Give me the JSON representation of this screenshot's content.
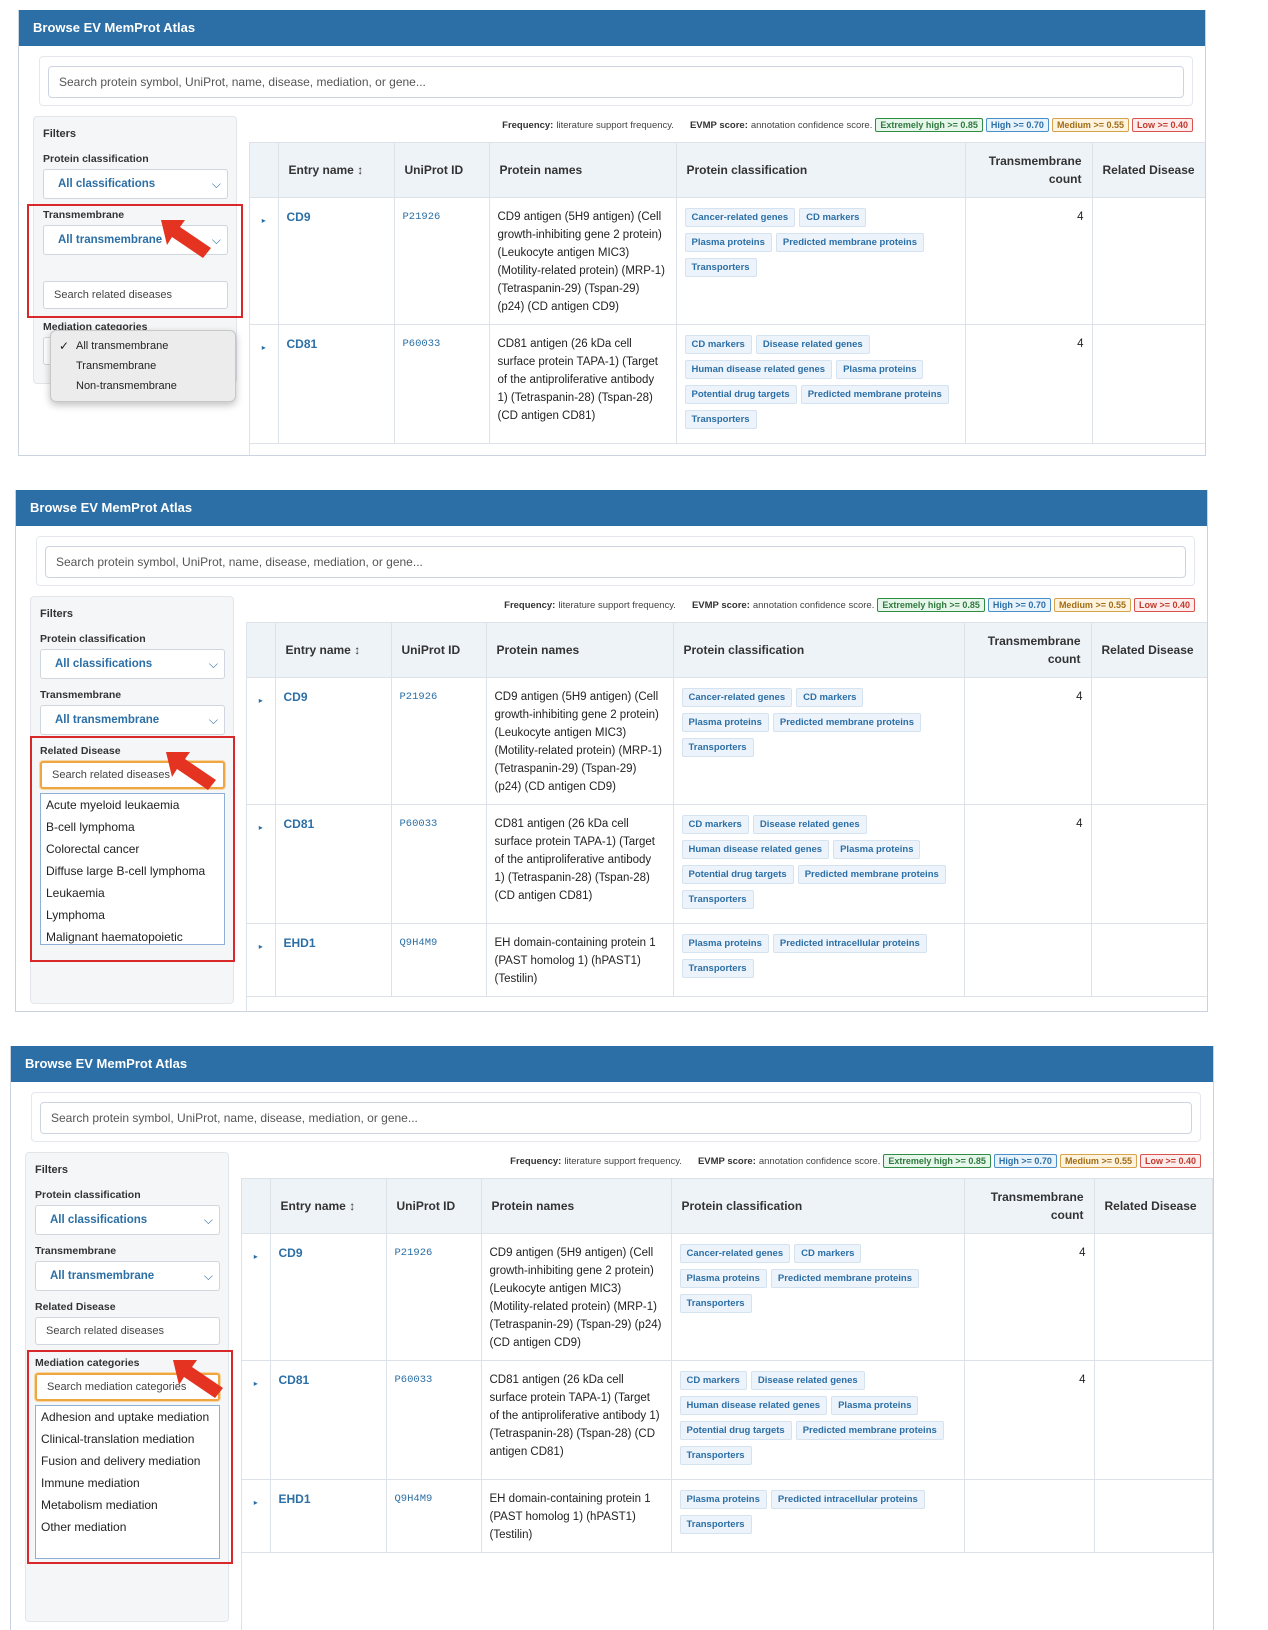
{
  "app_title": "Browse EV MemProt Atlas",
  "search_placeholder": "Search protein symbol, UniProt, name, disease, mediation, or gene...",
  "filters": {
    "title": "Filters",
    "protein_classification_label": "Protein classification",
    "protein_classification_value": "All classifications",
    "transmembrane_label": "Transmembrane",
    "transmembrane_value": "All transmembrane",
    "transmembrane_options": [
      "All transmembrane",
      "Transmembrane",
      "Non-transmembrane"
    ],
    "related_disease_label": "Related Disease",
    "related_disease_placeholder": "Search related diseases",
    "related_disease_partial": "Search related diseases",
    "mediation_label": "Mediation categories",
    "mediation_placeholder": "Search mediation categories"
  },
  "legend": {
    "frequency_label": "Frequency:",
    "frequency_text": "literature support frequency.",
    "evmp_label": "EVMP score:",
    "evmp_text": "annotation confidence score.",
    "badges": [
      "Extremely high >= 0.85",
      "High >= 0.70",
      "Medium >= 0.55",
      "Low >= 0.40"
    ]
  },
  "columns": [
    "Entry name ↕",
    "UniProt ID",
    "Protein names",
    "Protein classification",
    "Transmembrane count",
    "Related Disease"
  ],
  "rows": [
    {
      "entry": "CD9",
      "uniprot": "P21926",
      "names": "CD9 antigen (5H9 antigen) (Cell growth-inhibiting gene 2 protein) (Leukocyte antigen MIC3) (Motility-related protein) (MRP-1) (Tetraspanin-29) (Tspan-29) (p24) (CD antigen CD9)",
      "tags": [
        [
          "Cancer-related genes",
          "CD markers"
        ],
        [
          "Plasma proteins",
          "Predicted membrane proteins"
        ],
        [
          "Transporters"
        ]
      ],
      "tm": "4"
    },
    {
      "entry": "CD81",
      "uniprot": "P60033",
      "names": "CD81 antigen (26 kDa cell surface protein TAPA-1) (Target of the antiproliferative antibody 1) (Tetraspanin-28) (Tspan-28) (CD antigen CD81)",
      "tags": [
        [
          "CD markers",
          "Disease related genes"
        ],
        [
          "Human disease related genes",
          "Plasma proteins"
        ],
        [
          "Potential drug targets",
          "Predicted membrane proteins"
        ],
        [
          "Transporters"
        ]
      ],
      "tm": "4"
    },
    {
      "entry": "EHD1",
      "uniprot": "Q9H4M9",
      "names": "EH domain-containing protein 1 (PAST homolog 1) (hPAST1) (Testilin)",
      "tags": [
        [
          "Plasma proteins",
          "Predicted intracellular proteins"
        ],
        [
          "Transporters"
        ]
      ],
      "tm": ""
    }
  ],
  "disease_options": [
    "Acute myeloid leukaemia",
    "B-cell lymphoma",
    "Colorectal cancer",
    "Diffuse large B-cell lymphoma",
    "Leukaemia",
    "Lymphoma",
    "Malignant haematopoietic"
  ],
  "mediation_options": [
    "Adhesion and uptake mediation",
    "Clinical-translation mediation",
    "Fusion and delivery mediation",
    "Immune mediation",
    "Metabolism mediation",
    "Other mediation"
  ],
  "colors": {
    "header_blue": "#2b6fa6",
    "highlight_red": "#d8282a",
    "focus_orange": "#f0a640"
  }
}
